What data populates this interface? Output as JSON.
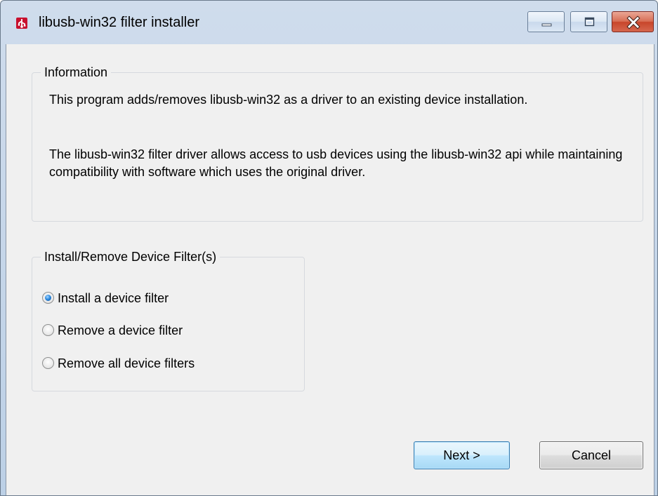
{
  "window": {
    "title": "libusb-win32 filter installer",
    "icon": "usb-app-icon"
  },
  "titlebar_buttons": {
    "minimize": "minimize-icon",
    "maximize": "maximize-icon",
    "close": "close-icon"
  },
  "information": {
    "legend": "Information",
    "paragraph1": "This program adds/removes libusb-win32 as a driver to an existing device installation.",
    "paragraph2": "The libusb-win32 filter driver allows access to usb devices using the libusb-win32 api while maintaining compatibility with software which uses the original driver."
  },
  "filter_group": {
    "legend": "Install/Remove Device Filter(s)",
    "options": [
      {
        "label": "Install a device filter",
        "selected": true
      },
      {
        "label": "Remove a device filter",
        "selected": false
      },
      {
        "label": "Remove all device filters",
        "selected": false
      }
    ]
  },
  "buttons": {
    "next": "Next >",
    "cancel": "Cancel"
  },
  "colors": {
    "client_background": "#f0f0f0",
    "titlebar": "#c6d6ea",
    "close_button": "#c8462b",
    "radio_selected": "#2f8be0"
  }
}
